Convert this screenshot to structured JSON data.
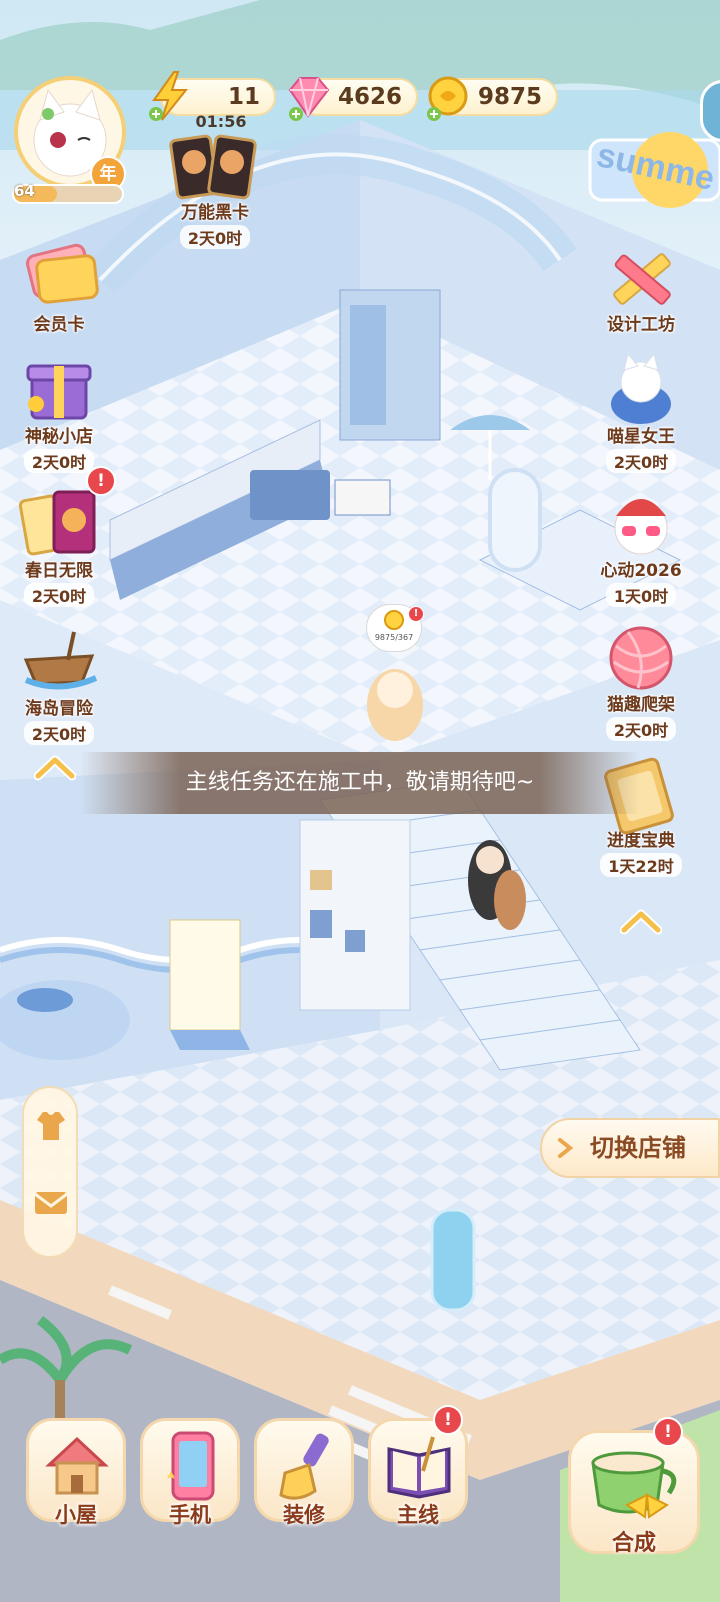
{
  "resources": {
    "energy": {
      "value": "11",
      "timer": "01:56"
    },
    "gems": {
      "value": "4626"
    },
    "coins": {
      "value": "9875"
    }
  },
  "player": {
    "level": "64",
    "avatar_badge": "年"
  },
  "top_event": {
    "label": "万能黑卡",
    "time": "2天0时"
  },
  "left_menu": [
    {
      "label": "会员卡",
      "time": ""
    },
    {
      "label": "神秘小店",
      "time": "2天0时"
    },
    {
      "label": "春日无限",
      "time": "2天0时",
      "badge": "!"
    },
    {
      "label": "海岛冒险",
      "time": "2天0时"
    }
  ],
  "right_menu": [
    {
      "label": "设计工坊",
      "time": ""
    },
    {
      "label": "喵星女王",
      "time": "2天0时"
    },
    {
      "label": "心动2026",
      "time": "1天0时"
    },
    {
      "label": "猫趣爬架",
      "time": "2天0时"
    },
    {
      "label": "进度宝典",
      "time": "1天22时"
    }
  ],
  "bubble": {
    "text": "9875/367",
    "badge": "!"
  },
  "toast": "主线任务还在施工中，敬请期待吧~",
  "switch_shop": "切换店铺",
  "bottom_bar": [
    {
      "label": "小屋"
    },
    {
      "label": "手机"
    },
    {
      "label": "装修"
    },
    {
      "label": "主线",
      "badge": "!"
    },
    {
      "label": "合成",
      "badge": "!"
    }
  ],
  "sign_text": "summe",
  "colors": {
    "accent": "#f5c04a",
    "text": "#6d3a1c",
    "badge": "#e8484b"
  }
}
